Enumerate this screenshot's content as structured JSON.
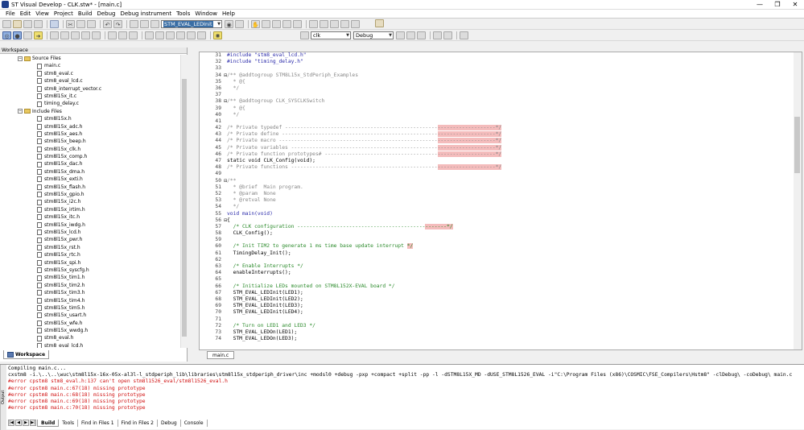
{
  "window": {
    "title": "ST Visual Develop - CLK.stw* - [main.c]",
    "controls": [
      "—",
      "❐",
      "✕"
    ]
  },
  "menu": [
    "File",
    "Edit",
    "View",
    "Project",
    "Build",
    "Debug",
    "Debug instrument",
    "Tools",
    "Window",
    "Help"
  ],
  "toolbar": {
    "search_value": "STM_EVAL_LEDInit",
    "target_value": "clk",
    "config_value": "Debug"
  },
  "workspace": {
    "title": "Workspace",
    "tab_label": "Workspace",
    "source_folder": "Source Files",
    "source_files": [
      "main.c",
      "stm8_eval.c",
      "stm8_eval_lcd.c",
      "stm8_interrupt_vector.c",
      "stm8l15x_it.c",
      "timing_delay.c"
    ],
    "include_folder": "Include Files",
    "include_files": [
      "stm8l15x.h",
      "stm8l15x_adc.h",
      "stm8l15x_aes.h",
      "stm8l15x_beep.h",
      "stm8l15x_clk.h",
      "stm8l15x_comp.h",
      "stm8l15x_dac.h",
      "stm8l15x_dma.h",
      "stm8l15x_exti.h",
      "stm8l15x_flash.h",
      "stm8l15x_gpio.h",
      "stm8l15x_i2c.h",
      "stm8l15x_irtim.h",
      "stm8l15x_itc.h",
      "stm8l15x_iwdg.h",
      "stm8l15x_lcd.h",
      "stm8l15x_pwr.h",
      "stm8l15x_rst.h",
      "stm8l15x_rtc.h",
      "stm8l15x_spi.h",
      "stm8l15x_syscfg.h",
      "stm8l15x_tim1.h",
      "stm8l15x_tim2.h",
      "stm8l15x_tim3.h",
      "stm8l15x_tim4.h",
      "stm8l15x_tim5.h",
      "stm8l15x_usart.h",
      "stm8l15x_wfe.h",
      "stm8l15x_wwdg.h",
      "stm8_eval.h",
      "stm8_eval_lcd.h"
    ]
  },
  "editor": {
    "tab_label": "main.c",
    "lines": [
      {
        "n": "31",
        "text": "#include \"stm8_eval_lcd.h\"",
        "cls": "pp",
        "fold": ""
      },
      {
        "n": "32",
        "text": "#include \"timing_delay.h\"",
        "cls": "pp",
        "fold": ""
      },
      {
        "n": "33",
        "text": "",
        "cls": "",
        "fold": ""
      },
      {
        "n": "34",
        "text": "/** @addtogroup STM8L15x_StdPeriph_Examples",
        "cls": "cmg",
        "fold": "⊟"
      },
      {
        "n": "35",
        "text": "  * @{",
        "cls": "cmg",
        "fold": ""
      },
      {
        "n": "36",
        "text": "  */",
        "cls": "cmg",
        "fold": ""
      },
      {
        "n": "37",
        "text": "",
        "cls": "",
        "fold": ""
      },
      {
        "n": "38",
        "text": "/** @addtogroup CLK_SYSCLKSwitch",
        "cls": "cmg",
        "fold": "⊟"
      },
      {
        "n": "39",
        "text": "  * @{",
        "cls": "cmg",
        "fold": ""
      },
      {
        "n": "40",
        "text": "  */",
        "cls": "cmg",
        "fold": ""
      },
      {
        "n": "41",
        "text": "",
        "cls": "",
        "fold": ""
      },
      {
        "n": "42",
        "text": "/* Private typedef --------------------------------------------------",
        "hl": "-------------------*/",
        "cls": "cmg",
        "fold": ""
      },
      {
        "n": "43",
        "text": "/* Private define ---------------------------------------------------",
        "hl": "-------------------*/",
        "cls": "cmg",
        "fold": ""
      },
      {
        "n": "44",
        "text": "/* Private macro ----------------------------------------------------",
        "hl": "-------------------*/",
        "cls": "cmg",
        "fold": ""
      },
      {
        "n": "45",
        "text": "/* Private variables ------------------------------------------------",
        "hl": "-------------------*/",
        "cls": "cmg",
        "fold": ""
      },
      {
        "n": "46",
        "text": "/* Private function prototypes# -------------------------------------",
        "hl": "-------------------*/",
        "cls": "cmg",
        "fold": ""
      },
      {
        "n": "47",
        "text": "static void CLK_Config(void);",
        "cls": "",
        "fold": ""
      },
      {
        "n": "48",
        "text": "/* Private functions ------------------------------------------------",
        "hl": "-------------------*/",
        "cls": "cmg",
        "fold": ""
      },
      {
        "n": "49",
        "text": "",
        "cls": "",
        "fold": ""
      },
      {
        "n": "50",
        "text": "/**",
        "cls": "cmg",
        "fold": "⊟"
      },
      {
        "n": "51",
        "text": "  * @brief  Main program.",
        "cls": "cmg",
        "fold": ""
      },
      {
        "n": "52",
        "text": "  * @param  None",
        "cls": "cmg",
        "fold": ""
      },
      {
        "n": "53",
        "text": "  * @retval None",
        "cls": "cmg",
        "fold": ""
      },
      {
        "n": "54",
        "text": "  */",
        "cls": "cmg",
        "fold": ""
      },
      {
        "n": "55",
        "text": "void main(void)",
        "cls": "pp",
        "fold": ""
      },
      {
        "n": "56",
        "text": "{",
        "cls": "",
        "fold": "⊟"
      },
      {
        "n": "57",
        "text": "  /* CLK configuration ------------------------------------------",
        "hl": "-------*/",
        "cls": "cm",
        "fold": ""
      },
      {
        "n": "58",
        "text": "  CLK_Config();",
        "cls": "",
        "fold": ""
      },
      {
        "n": "59",
        "text": "",
        "cls": "",
        "fold": ""
      },
      {
        "n": "60",
        "text": "  /* Init TIM2 to generate 1 ms time base update interrupt ",
        "hl": "*/",
        "cls": "cm",
        "fold": ""
      },
      {
        "n": "61",
        "text": "  TimingDelay_Init();",
        "cls": "",
        "fold": ""
      },
      {
        "n": "62",
        "text": "",
        "cls": "",
        "fold": ""
      },
      {
        "n": "63",
        "text": "  /* Enable Interrupts */",
        "cls": "cm",
        "fold": ""
      },
      {
        "n": "64",
        "text": "  enableInterrupts();",
        "cls": "",
        "fold": ""
      },
      {
        "n": "65",
        "text": "",
        "cls": "",
        "fold": ""
      },
      {
        "n": "66",
        "text": "  /* Initialize LEDs mounted on STM8L152X-EVAL board */",
        "cls": "cm",
        "fold": ""
      },
      {
        "n": "67",
        "text": "  STM_EVAL_LEDInit(LED1);",
        "cls": "",
        "fold": ""
      },
      {
        "n": "68",
        "text": "  STM_EVAL_LEDInit(LED2);",
        "cls": "",
        "fold": ""
      },
      {
        "n": "69",
        "text": "  STM_EVAL_LEDInit(LED3);",
        "cls": "",
        "fold": ""
      },
      {
        "n": "70",
        "text": "  STM_EVAL_LEDInit(LED4);",
        "cls": "",
        "fold": ""
      },
      {
        "n": "71",
        "text": "",
        "cls": "",
        "fold": ""
      },
      {
        "n": "72",
        "text": "  /* Turn on LED1 and LED3 */",
        "cls": "cm",
        "fold": ""
      },
      {
        "n": "73",
        "text": "  STM_EVAL_LEDOn(LED1);",
        "cls": "",
        "fold": ""
      },
      {
        "n": "74",
        "text": "  STM_EVAL_LEDOn(LED3);",
        "cls": "",
        "fold": ""
      }
    ]
  },
  "output": {
    "side_label": "Output",
    "lines": [
      {
        "text": "Compiling main.c...",
        "err": false
      },
      {
        "text": "cxstm8 -i.\\..\\..\\wuc\\stm8l15x-16x-05x-al3l-l_stdperiph_lib\\libraries\\stm8l15x_stdperiph_driver\\inc +modsl0 +debug -pxp +compact +split -pp -l -dSTM8L15X_MD -dUSE_STM8L1526_EVAL -i\"C:\\Program Files (x86)\\COSMIC\\FSE_Compilers\\Hstm8\" -clDebug\\ -coDebug\\ main.c",
        "err": false
      },
      {
        "text": "#error cpstm8 stm8_eval.h:137 can't open stm8l1526_eval/stm8l1526_eval.h",
        "err": true
      },
      {
        "text": "#error cpstm8 main.c:67(18) missing prototype",
        "err": true
      },
      {
        "text": "#error cpstm8 main.c:68(18) missing prototype",
        "err": true
      },
      {
        "text": "#error cpstm8 main.c:69(18) missing prototype",
        "err": true
      },
      {
        "text": "#error cpstm8 main.c:70(18) missing prototype",
        "err": true
      }
    ],
    "tabs": [
      "Build",
      "Tools",
      "Find in Files 1",
      "Find in Files 2",
      "Debug",
      "Console"
    ],
    "active_tab": "Build"
  }
}
